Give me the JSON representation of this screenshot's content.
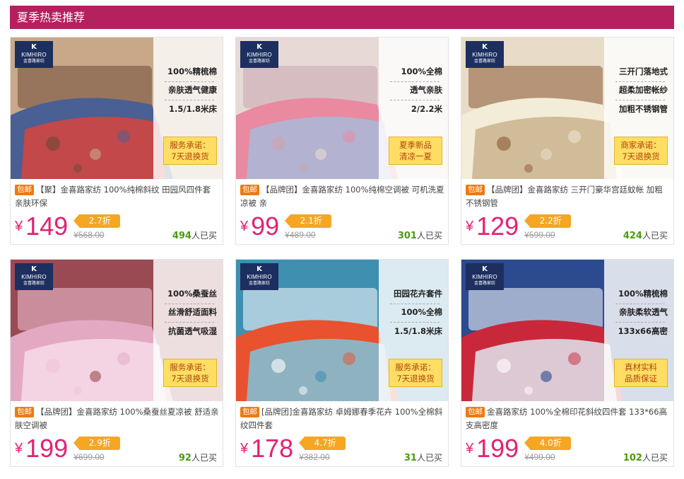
{
  "section_title": "夏季热卖推荐",
  "logo": {
    "brand": "KIMHIRO",
    "cn": "金喜路家纺"
  },
  "products": [
    {
      "features": [
        "100%精梳棉",
        "亲肤透气健康",
        "1.5/1.8米床"
      ],
      "promise": [
        "服务承诺：",
        "7天退换货"
      ],
      "tag": "包邮",
      "title": "【聚】金喜路家纺 100%纯棉斜纹 田园风四件套 亲肤环保",
      "yen": "¥",
      "price": "149",
      "discount": "2.7折",
      "original": "¥568.00",
      "sold_count": "494",
      "sold_suffix": "人已买",
      "photo_colors": [
        "#c9a889",
        "#6d4a38",
        "#4a5f93",
        "#d7443d"
      ]
    },
    {
      "features": [
        "100%全棉",
        "透气亲肤",
        "2/2.2米"
      ],
      "promise": [
        "夏季新品",
        "清凉一夏"
      ],
      "tag": "包邮",
      "title": "【品牌团】金喜路家纺 100%纯棉空调被 可机洗夏凉被 亲",
      "yen": "¥",
      "price": "99",
      "discount": "2.1折",
      "original": "¥489.00",
      "sold_count": "301",
      "sold_suffix": "人已买",
      "photo_colors": [
        "#e7d9d5",
        "#c9a5b2",
        "#e98aa0",
        "#a9b8d8"
      ]
    },
    {
      "features": [
        "三开门落地式",
        "超柔加密帐纱",
        "加粗不锈钢管"
      ],
      "promise": [
        "商家承诺：",
        "7天退换货"
      ],
      "tag": "包邮",
      "title": "【品牌团】金喜路家纺 三开门豪华宫廷蚊帐 加粗不锈钢管",
      "yen": "¥",
      "price": "129",
      "discount": "2.2折",
      "original": "¥599.00",
      "sold_count": "424",
      "sold_suffix": "人已买",
      "photo_colors": [
        "#e8dcc8",
        "#8a5a36",
        "#f3ecd8",
        "#c9b48e"
      ]
    },
    {
      "features": [
        "100%桑蚕丝",
        "丝滑舒适面料",
        "抗菌透气吸湿"
      ],
      "promise": [
        "服务承诺：",
        "7天退换货"
      ],
      "tag": "包邮",
      "title": "【品牌团】金喜路家纺 100%桑蚕丝夏凉被 舒适亲肤空调被",
      "yen": "¥",
      "price": "199",
      "discount": "2.9折",
      "original": "¥699.00",
      "sold_count": "92",
      "sold_suffix": "人已买",
      "photo_colors": [
        "#9a4a52",
        "#f0c4d8",
        "#e3a9c3",
        "#f7dbe8"
      ]
    },
    {
      "features": [
        "田园花卉套件",
        "100%全棉",
        "1.5/1.8米床"
      ],
      "promise": [
        "服务承诺：",
        "7天退换货"
      ],
      "tag": "包邮",
      "title": "[品牌团]金喜路家纺 卓姆娜春季花卉 100%全棉斜纹四件套",
      "yen": "¥",
      "price": "178",
      "discount": "4.7折",
      "original": "¥382.00",
      "sold_count": "31",
      "sold_suffix": "人已买",
      "photo_colors": [
        "#3f8fb0",
        "#ffffff",
        "#e8522f",
        "#7fc3d9"
      ]
    },
    {
      "features": [
        "100%精梳棉",
        "亲肤柔软透气",
        "133x66高密"
      ],
      "promise": [
        "真材实料",
        "品质保证"
      ],
      "tag": "包邮",
      "title": "金喜路家纺 100%全棉印花斜纹四件套 133*66高支高密度",
      "yen": "¥",
      "price": "199",
      "discount": "4.0折",
      "original": "¥499.00",
      "sold_count": "102",
      "sold_suffix": "人已买",
      "photo_colors": [
        "#2c4a8f",
        "#ffffff",
        "#c9283a",
        "#dfe5ef"
      ]
    }
  ]
}
